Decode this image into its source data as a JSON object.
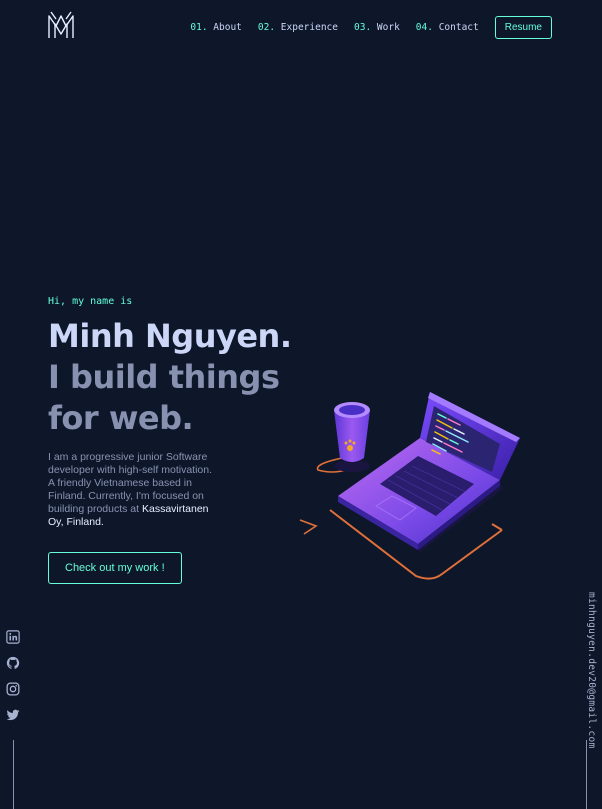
{
  "header": {
    "logo_icon": "mm-monogram-logo-icon",
    "nav": [
      {
        "num": "01.",
        "label": "About"
      },
      {
        "num": "02.",
        "label": "Experience"
      },
      {
        "num": "03.",
        "label": "Work"
      },
      {
        "num": "04.",
        "label": "Contact"
      }
    ],
    "resume_label": "Resume"
  },
  "hero": {
    "greeting": "Hi, my name is",
    "name": "Minh Nguyen.",
    "tagline": "I build things for web.",
    "bio_text": "I am a progressive junior Software developer with high-self motivation. A friendly Vietnamese based in Finland. Currently, I'm focused on building products at ",
    "bio_highlight": "Kassavirtanen Oy, Finland.",
    "cta_label": "Check out my work !",
    "illustration": "laptop-and-coffee-cup-illustration"
  },
  "social": {
    "icons": [
      "linkedin-icon",
      "github-icon",
      "instagram-icon",
      "twitter-icon"
    ]
  },
  "email": "minhnguyen.dev20@gmail.com",
  "colors": {
    "background": "#0e172a",
    "accent": "#64ffda",
    "heading": "#ccd6f6",
    "text": "#8892b0"
  }
}
